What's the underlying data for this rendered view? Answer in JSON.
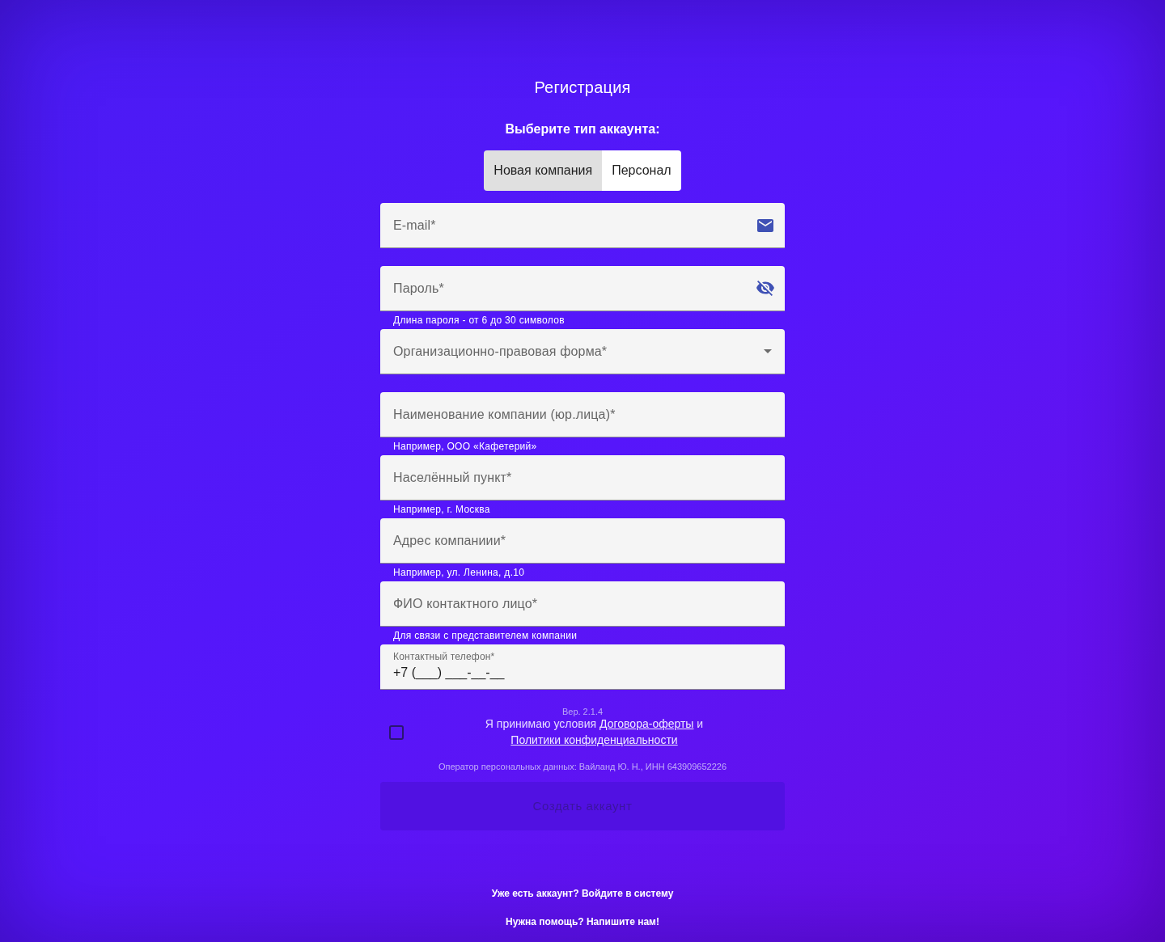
{
  "title": "Регистрация",
  "account_type": {
    "label": "Выберите тип аккаунта:",
    "options": [
      {
        "label": "Новая компания",
        "selected": true
      },
      {
        "label": "Персонал",
        "selected": false
      }
    ]
  },
  "fields": [
    {
      "kind": "email",
      "label": "E-mail*"
    },
    {
      "kind": "password",
      "label": "Пароль*",
      "helper": "Длина пароля - от 6 до 30 символов"
    },
    {
      "kind": "select",
      "label": "Организационно-правовая форма*"
    },
    {
      "kind": "text",
      "label": "Наименование компании (юр.лица)*",
      "helper": "Например, ООО «Кафетерий»"
    },
    {
      "kind": "text",
      "label": "Населённый пункт*",
      "helper": "Например, г. Москва"
    },
    {
      "kind": "text",
      "label": "Адрес компаниии*",
      "helper": "Например, ул. Ленина, д.10"
    },
    {
      "kind": "text",
      "label": "ФИО контактного лицо*",
      "helper": "Для связи с представителем компании"
    },
    {
      "kind": "phone",
      "label": "Контактный телефон*",
      "value": "+7 (___) ___-__-__"
    }
  ],
  "version": "Вер. 2.1.4",
  "consent": {
    "checked": false,
    "parts": [
      {
        "kind": "text",
        "text": "Я принимаю условия"
      },
      {
        "kind": "link",
        "text": "Договора-оферты"
      },
      {
        "kind": "text",
        "text": "и"
      },
      {
        "kind": "link",
        "text": "Политики конфиденциальности"
      }
    ]
  },
  "operator_note": "Оператор персональных данных: Вайланд Ю. Н., ИНН 643909652226",
  "submit": {
    "label": "Создать аккаунт",
    "disabled": true
  },
  "footer_links": [
    "Уже есть аккаунт? Войдите в систему",
    "Нужна помощь? Напишите нам!"
  ]
}
